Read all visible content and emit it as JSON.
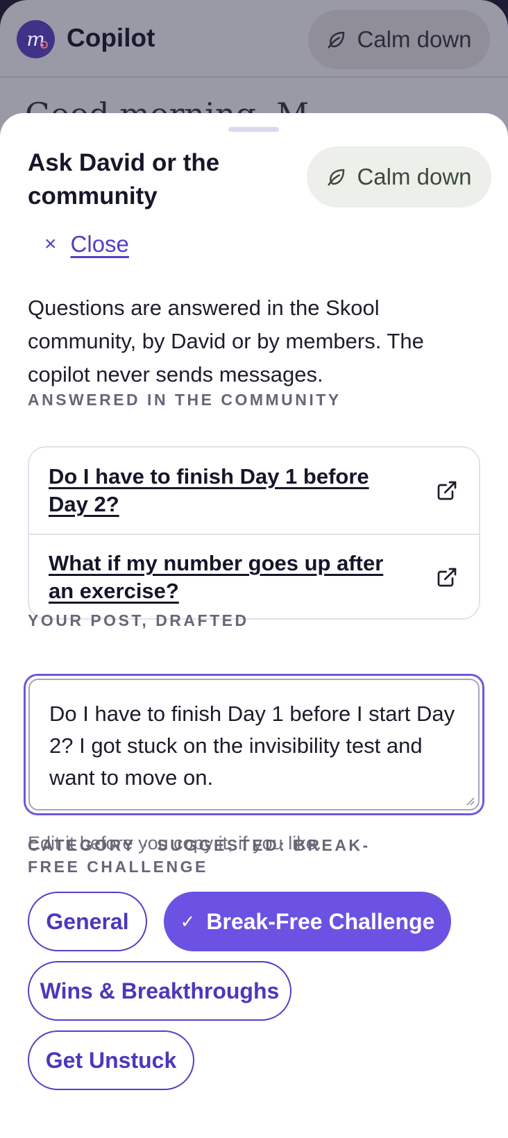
{
  "app": {
    "logo_text": "m",
    "title": "Copilot",
    "calm_label": "Calm down",
    "heading_partial": "Good morning, M"
  },
  "sheet": {
    "title": "Ask David or the community",
    "calm_label": "Calm down",
    "close_label": "Close",
    "close_icon": "×",
    "intro": "Questions are answered in the Skool community, by David or by members. The copilot never sends messages.",
    "answered_label": "ANSWERED IN THE COMMUNITY",
    "answered": [
      {
        "question": "Do I have to finish Day 1 before Day 2?",
        "icon": "external-link-icon"
      },
      {
        "question": "What if my number goes up after an exercise?",
        "icon": "external-link-icon"
      }
    ],
    "draft_label": "YOUR POST, DRAFTED",
    "draft_text": "Do I have to finish Day 1 before I start Day 2? I got stuck on the invisibility test and want to move on.",
    "hint": "Edit it before you copy it, if you like.",
    "category_label": "CATEGORY · SUGGESTED: BREAK-FREE CHALLENGE",
    "categories": [
      {
        "label": "General",
        "selected": false
      },
      {
        "label": "Break-Free Challenge",
        "selected": true
      },
      {
        "label": "Wins & Breakthroughs",
        "selected": false
      },
      {
        "label": "Get Unstuck",
        "selected": false
      }
    ],
    "check_icon": "✓"
  },
  "colors": {
    "accent": "#6b52e3",
    "accent_text": "#5140c4",
    "calm_bg": "#edf0ea",
    "scrim": "#9a99a6"
  }
}
